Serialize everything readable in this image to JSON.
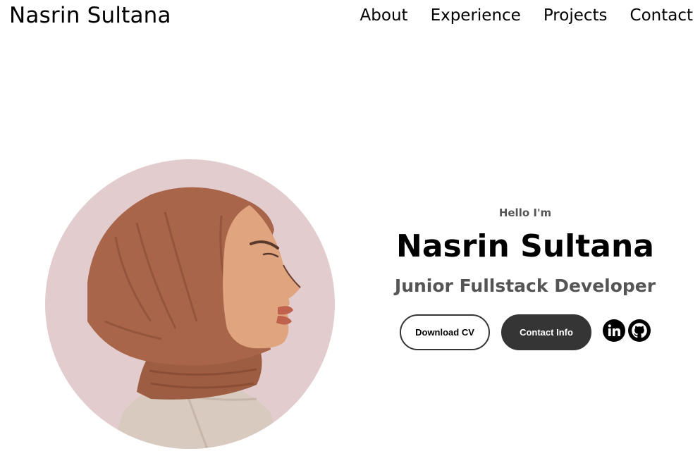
{
  "nav": {
    "logo": "Nasrin Sultana",
    "links": [
      {
        "label": "About"
      },
      {
        "label": "Experience"
      },
      {
        "label": "Projects"
      },
      {
        "label": "Contact"
      }
    ]
  },
  "profile": {
    "greeting": "Hello I'm",
    "name": "Nasrin Sultana",
    "role": "Junior Fullstack Developer",
    "picture_icon": "avatar-illustration",
    "picture_bg_color": "#e3cccd"
  },
  "buttons": {
    "download_cv": "Download CV",
    "contact_info": "Contact Info"
  },
  "socials": [
    {
      "icon": "linkedin-icon"
    },
    {
      "icon": "github-icon"
    }
  ],
  "colors": {
    "text": "#000000",
    "muted": "#555555",
    "button_dark": "#353535",
    "hijab": "#a8654a",
    "skin": "#e0a57e"
  }
}
